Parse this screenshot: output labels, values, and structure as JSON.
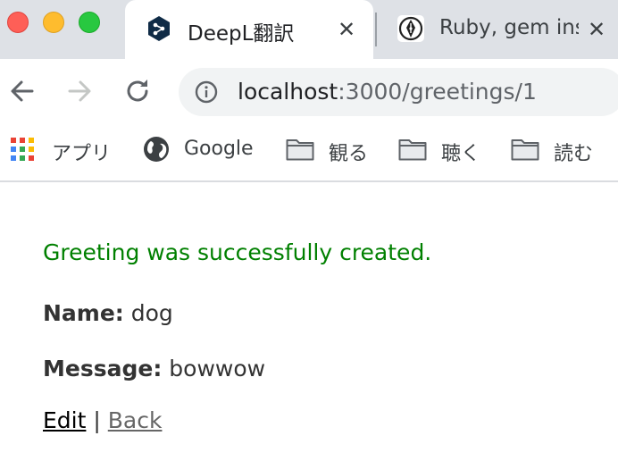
{
  "browser": {
    "tabs": [
      {
        "title": "DeepL翻訳",
        "icon": "deepl-icon",
        "active": true,
        "close": "✕"
      },
      {
        "title": "Ruby, gem ins",
        "icon": "pen-nib-icon",
        "active": false,
        "close": "✕"
      }
    ],
    "address": {
      "host": "localhost",
      "rest": ":3000/greetings/1"
    },
    "bookmarks": [
      {
        "label": "アプリ",
        "icon": "apps-grid-icon"
      },
      {
        "label": "Google",
        "icon": "globe-icon"
      },
      {
        "label": "観る",
        "icon": "folder-icon"
      },
      {
        "label": "聴く",
        "icon": "folder-icon"
      },
      {
        "label": "読む",
        "icon": "folder-icon"
      }
    ]
  },
  "page": {
    "notice": "Greeting was successfully created.",
    "name_label": "Name:",
    "name_value": "dog",
    "message_label": "Message:",
    "message_value": "bowwow",
    "edit_link": "Edit",
    "separator": "|",
    "back_link": "Back"
  },
  "colors": {
    "notice": "#008000",
    "tab_strip": "#dee1e6",
    "omnibox": "#f1f3f4"
  }
}
